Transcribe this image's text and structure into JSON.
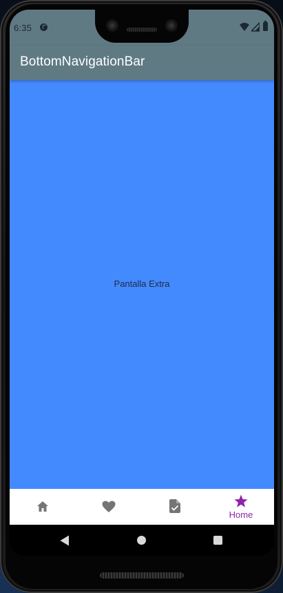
{
  "status_bar": {
    "time": "6:35",
    "background": "#607a84",
    "icons": [
      "app-notification-icon",
      "wifi-icon",
      "signal-icon",
      "battery-icon"
    ]
  },
  "app_bar": {
    "title": "BottomNavigationBar",
    "background": "#607a84"
  },
  "content": {
    "text": "Pantalla Extra",
    "background": "#448aff"
  },
  "bottom_nav": {
    "selected_index": 3,
    "selected_color": "#8e24aa",
    "unselected_color": "#757575",
    "items": [
      {
        "icon": "home-icon",
        "label": ""
      },
      {
        "icon": "heart-icon",
        "label": ""
      },
      {
        "icon": "task-document-icon",
        "label": ""
      },
      {
        "icon": "star-icon",
        "label": "Home"
      }
    ]
  },
  "system_nav": {
    "icons": [
      "back-icon",
      "home-icon",
      "recents-icon"
    ]
  }
}
